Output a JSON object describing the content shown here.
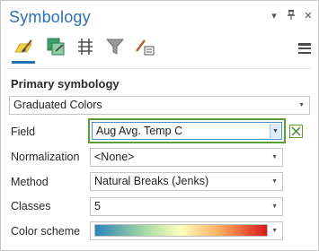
{
  "pane": {
    "title": "Symbology",
    "controls": {
      "menu": "▾",
      "pin": "📌",
      "close": "✕"
    }
  },
  "toolbar": {
    "tools": [
      {
        "name": "primary-symbology",
        "active": true
      },
      {
        "name": "vary-symbology",
        "active": false
      },
      {
        "name": "symbol-layers",
        "active": false
      },
      {
        "name": "filter",
        "active": false
      },
      {
        "name": "label-edit",
        "active": false
      }
    ]
  },
  "primary": {
    "heading": "Primary symbology",
    "method_select": "Graduated Colors"
  },
  "form": {
    "field_label": "Field",
    "field_value": "Aug  Avg. Temp C",
    "normalization_label": "Normalization",
    "normalization_value": "<None>",
    "method_label": "Method",
    "method_value": "Natural Breaks (Jenks)",
    "classes_label": "Classes",
    "classes_value": "5",
    "color_scheme_label": "Color scheme"
  },
  "colors": {
    "accent": "#2b6fb4",
    "highlight": "#5a9f35",
    "ramp": [
      "#2b83ba",
      "#abdda4",
      "#ffffbf",
      "#fdae61",
      "#d7191c"
    ]
  }
}
